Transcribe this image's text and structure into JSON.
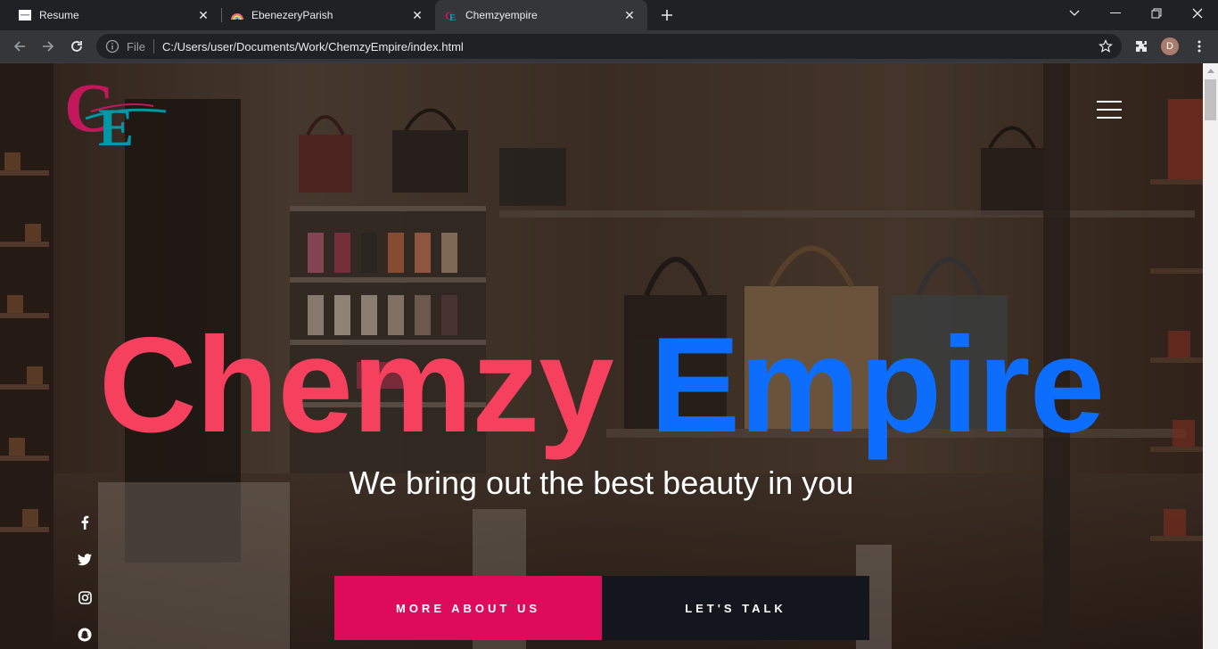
{
  "browser": {
    "tabs": [
      {
        "title": "Resume",
        "active": false
      },
      {
        "title": "EbenezeryParish",
        "active": false
      },
      {
        "title": "Chemzyempire",
        "active": true
      }
    ],
    "address": {
      "scheme_label": "File",
      "url": "C:/Users/user/Documents/Work/ChemzyEmpire/index.html"
    },
    "profile_initial": "D"
  },
  "page": {
    "logo_letters": "CE",
    "hero": {
      "title_word1": "Chemzy",
      "title_word2": "Empire",
      "subtitle": "We bring out the best beauty in you"
    },
    "buttons": {
      "primary": "MORE ABOUT US",
      "secondary": "LET'S TALK"
    },
    "social": [
      "facebook-icon",
      "twitter-icon",
      "instagram-icon",
      "snapchat-icon"
    ],
    "colors": {
      "title_primary": "#f5405e",
      "title_secondary": "#0d6efd",
      "button_primary": "#de0b5b",
      "button_dark": "#14161d"
    }
  }
}
